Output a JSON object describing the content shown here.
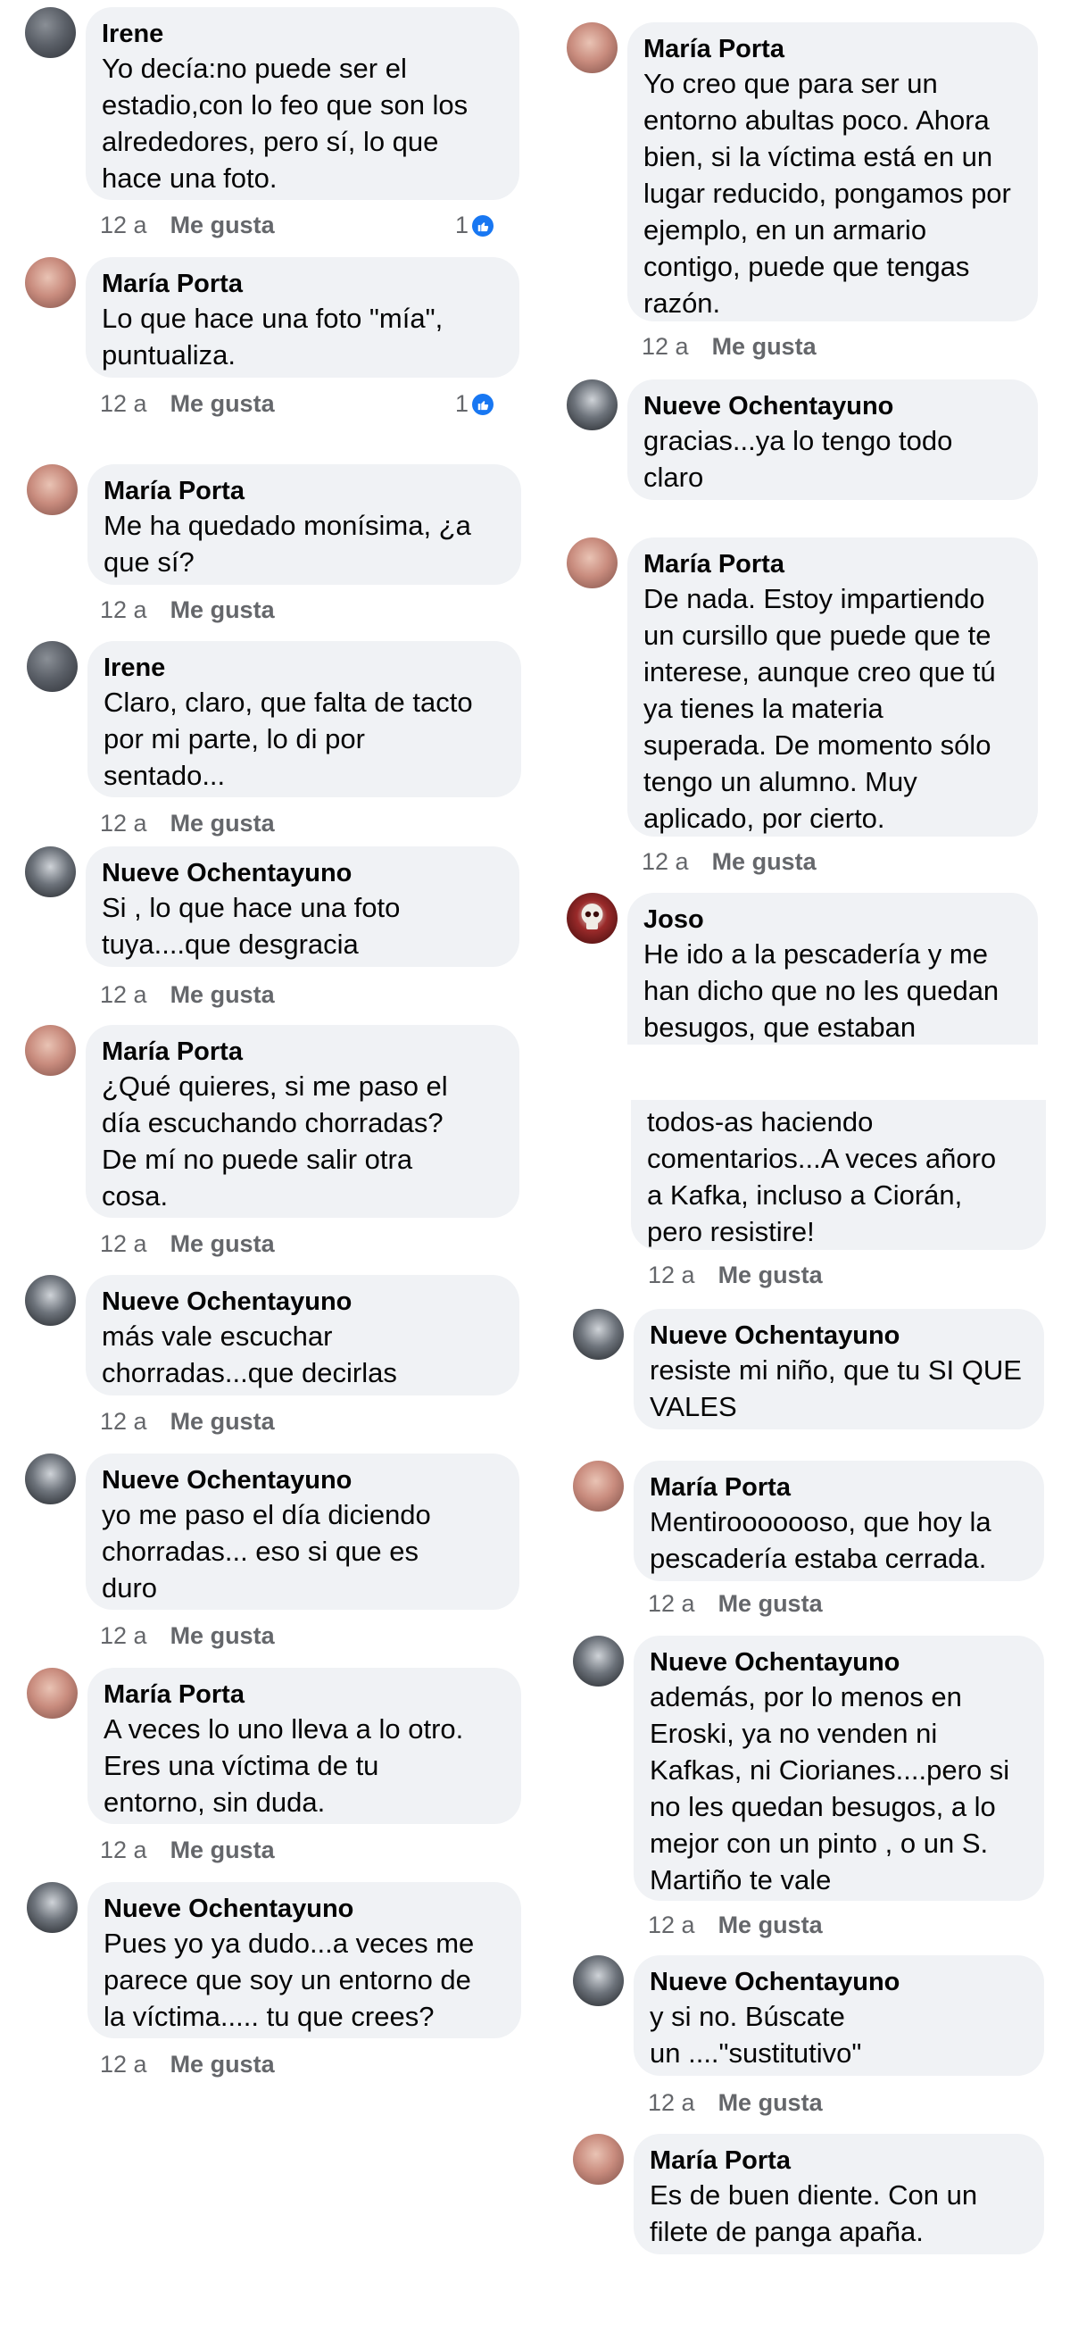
{
  "labels": {
    "time": "12 a",
    "like": "Me gusta"
  },
  "comments": [
    {
      "author": "Irene",
      "text": "Yo decía:no puede ser el\nestadio,con lo feo que son los\nalrededores, pero sí, lo que\nhace una foto.",
      "reactions": "1"
    },
    {
      "author": "María Porta",
      "text": "Lo que hace una foto \"mía\",\npuntualiza.",
      "reactions": "1"
    },
    {
      "author": "María Porta",
      "text": "Me ha quedado monísima, ¿a\nque sí?"
    },
    {
      "author": "Irene",
      "text": "Claro, claro, que falta de tacto\npor mi parte, lo di por\nsentado..."
    },
    {
      "author": "Nueve Ochentayuno",
      "text": "Si , lo que hace una foto\ntuya....que desgracia"
    },
    {
      "author": "María Porta",
      "text": "¿Qué quieres, si me paso el\ndía escuchando chorradas?\nDe mí no puede salir otra\ncosa."
    },
    {
      "author": "Nueve Ochentayuno",
      "text": "más vale escuchar\nchorradas...que decirlas"
    },
    {
      "author": "Nueve Ochentayuno",
      "text": "yo me paso el día diciendo\nchorradas... eso si que es\nduro"
    },
    {
      "author": "María Porta",
      "text": "A veces lo uno lleva a lo otro.\nEres una víctima de tu\nentorno, sin duda."
    },
    {
      "author": "Nueve Ochentayuno",
      "text": "Pues yo ya dudo...a veces me\nparece que soy un entorno de\nla víctima..... tu que crees?"
    },
    {
      "author": "María Porta",
      "text": "Yo creo que para ser un\nentorno abultas poco. Ahora\nbien, si la víctima está en un\nlugar reducido, pongamos por\nejemplo, en un armario\ncontigo, puede que tengas\nrazón."
    },
    {
      "author": "Nueve Ochentayuno",
      "text": "gracias...ya lo tengo todo\nclaro"
    },
    {
      "author": "María Porta",
      "text": "De nada. Estoy impartiendo\nun cursillo que puede que te\ninterese, aunque creo que tú\nya tienes la materia\nsuperada. De momento sólo\ntengo un alumno. Muy\naplicado, por cierto."
    },
    {
      "author": "Joso",
      "text": "He ido a la pescadería y me\nhan dicho que no les quedan\nbesugos, que estaban"
    },
    {
      "text": "todos-as haciendo\ncomentarios...A veces añoro\na Kafka, incluso a Ciorán,\npero resistire!"
    },
    {
      "author": "Nueve Ochentayuno",
      "text": "resiste mi niño, que tu SI QUE\nVALES"
    },
    {
      "author": "María Porta",
      "text": "Mentirooooooso, que hoy la\npescadería estaba cerrada."
    },
    {
      "author": "Nueve Ochentayuno",
      "text": "además, por lo menos en\nEroski, ya no venden ni\nKafkas, ni Ciorianes....pero si\nno les quedan besugos, a lo\nmejor con un pinto , o un S.\nMartiño te vale"
    },
    {
      "author": "Nueve Ochentayuno",
      "text": "y si no. Búscate\nun ....\"sustitutivo\""
    },
    {
      "author": "María Porta",
      "text": "Es de buen diente. Con un\nfilete de panga apaña."
    }
  ]
}
